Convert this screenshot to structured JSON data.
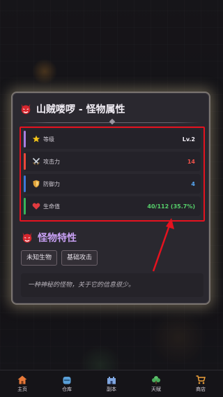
{
  "modal": {
    "title": "山贼喽啰 - 怪物属性",
    "stats": [
      {
        "icon": "star-icon",
        "label": "等级",
        "value": "Lv.2",
        "accent": "#a77fe0",
        "value_color": "#f4f0f7"
      },
      {
        "icon": "sword-icon",
        "label": "攻击力",
        "value": "14",
        "accent": "#e8473b",
        "value_color": "#f0524a"
      },
      {
        "icon": "shield-icon",
        "label": "防御力",
        "value": "4",
        "accent": "#3d78d6",
        "value_color": "#56a6f2"
      },
      {
        "icon": "heart-icon",
        "label": "生命值",
        "value": "40/112 (35.7%)",
        "accent": "#38b25a",
        "value_color": "#56d16b"
      }
    ],
    "traits_title": "怪物特性",
    "traits": [
      "未知生物",
      "基础攻击"
    ],
    "description": "一种神秘的怪物，关于它的信息很少。"
  },
  "nav": {
    "items": [
      {
        "label": "主页",
        "icon": "home-icon"
      },
      {
        "label": "仓库",
        "icon": "storage-icon"
      },
      {
        "label": "副本",
        "icon": "dungeon-icon"
      },
      {
        "label": "天赋",
        "icon": "talent-icon"
      },
      {
        "label": "商店",
        "icon": "shop-icon"
      }
    ]
  },
  "colors": {
    "highlight": "#e5121f",
    "traits_title": "#c9a1f5"
  }
}
